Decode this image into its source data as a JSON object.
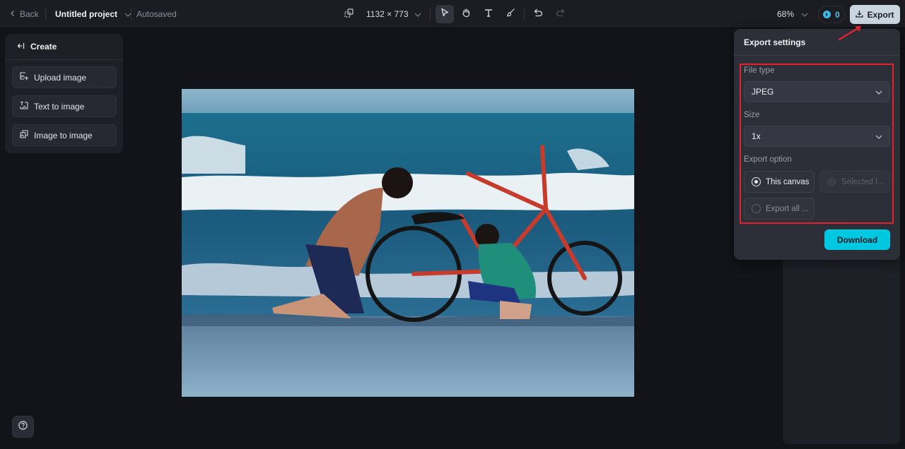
{
  "topbar": {
    "back_label": "Back",
    "project_name": "Untitled project",
    "save_status": "Autosaved",
    "canvas_size": "1132 × 773",
    "tools": [
      {
        "name": "select",
        "icon": "cursor-arrow-icon",
        "active": true
      },
      {
        "name": "hand",
        "icon": "hand-icon",
        "active": false
      },
      {
        "name": "text",
        "icon": "text-icon",
        "active": false
      },
      {
        "name": "brush",
        "icon": "brush-icon",
        "active": false
      },
      {
        "name": "undo",
        "icon": "undo-icon",
        "active": false
      },
      {
        "name": "redo",
        "icon": "redo-icon",
        "disabled": true
      }
    ],
    "zoom_level": "68%",
    "credits": "0",
    "export_label": "Export"
  },
  "create_panel": {
    "title": "Create",
    "items": [
      {
        "label": "Upload image",
        "icon": "upload-image-icon"
      },
      {
        "label": "Text to image",
        "icon": "text-to-image-icon"
      },
      {
        "label": "Image to image",
        "icon": "image-to-image-icon"
      }
    ]
  },
  "canvas": {
    "image_description": "Man and boy fixing a red bicycle in the ocean surf on a beach"
  },
  "export_settings": {
    "title": "Export settings",
    "file_type_label": "File type",
    "file_type_value": "JPEG",
    "size_label": "Size",
    "size_value": "1x",
    "export_option_label": "Export option",
    "options": [
      {
        "label": "This canvas",
        "state": "checked"
      },
      {
        "label": "Selected l...",
        "state": "disabled"
      },
      {
        "label": "Export all ...",
        "state": "unchecked"
      }
    ],
    "download_label": "Download"
  },
  "colors": {
    "accent": "#00c8e0",
    "highlight": "#e5222c",
    "export_button": "#c9d6df",
    "background": "#131419"
  }
}
